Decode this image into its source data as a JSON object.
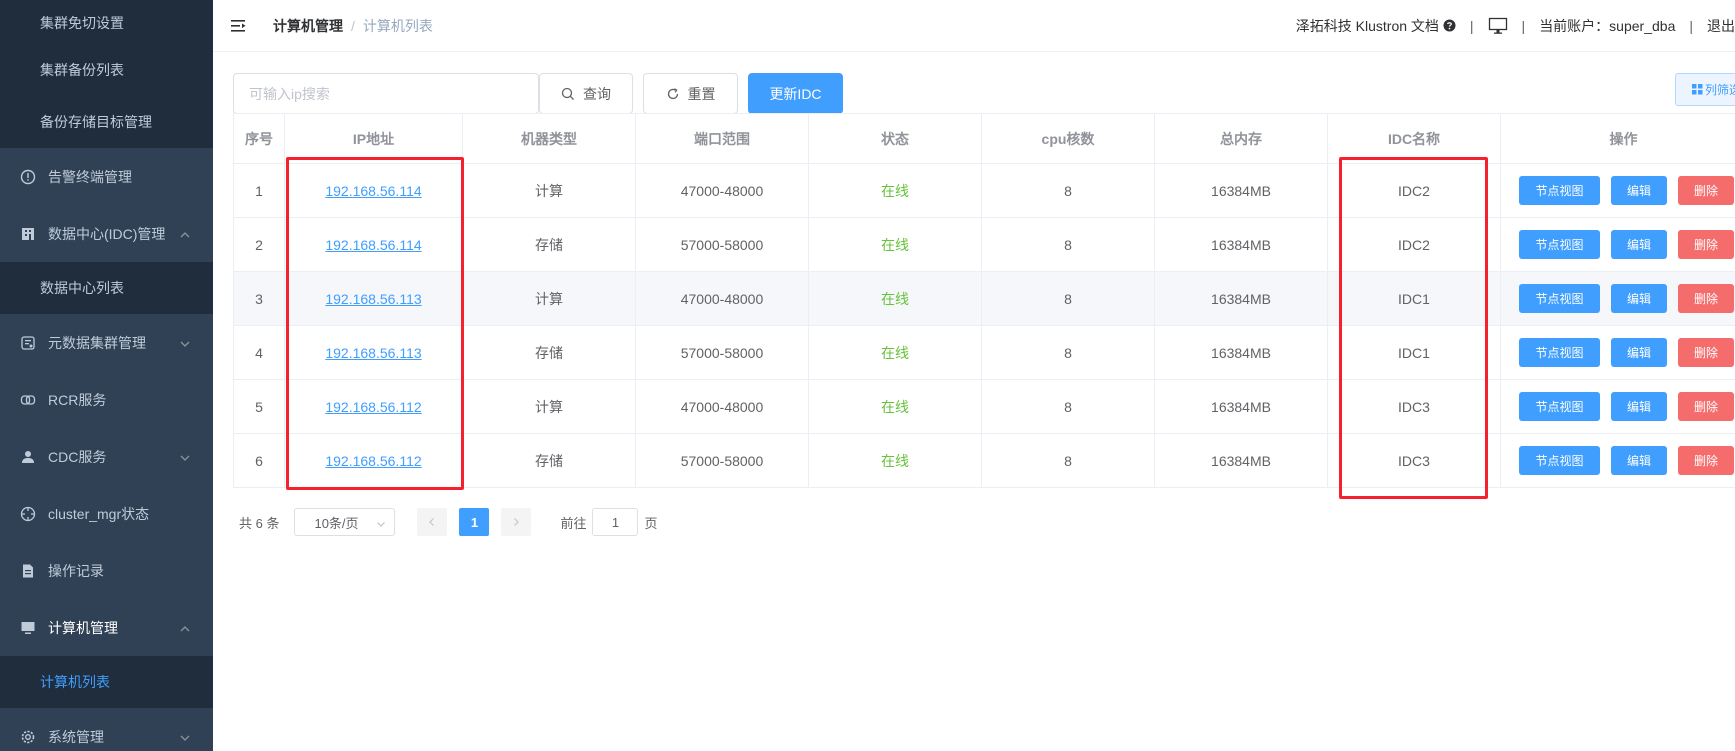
{
  "sidebar": {
    "top_items": [
      {
        "label": "集群免切设置"
      },
      {
        "label": "集群备份列表"
      },
      {
        "label": "备份存储目标管理"
      }
    ],
    "menu": {
      "alert": {
        "label": "告警终端管理",
        "icon": "alert-circle-icon"
      },
      "idc": {
        "label": "数据中心(IDC)管理",
        "icon": "building-icon",
        "expanded": true
      },
      "idc_list": {
        "label": "数据中心列表"
      },
      "meta": {
        "label": "元数据集群管理",
        "icon": "database-icon"
      },
      "rcr": {
        "label": "RCR服务",
        "icon": "link-icon"
      },
      "cdc": {
        "label": "CDC服务",
        "icon": "user-icon"
      },
      "cluster_mgr": {
        "label": "cluster_mgr状态",
        "icon": "compass-icon"
      },
      "oplog": {
        "label": "操作记录",
        "icon": "document-icon"
      },
      "machine": {
        "label": "计算机管理",
        "icon": "monitor-icon",
        "expanded": true
      },
      "machine_list": {
        "label": "计算机列表",
        "active": true
      },
      "system": {
        "label": "系统管理",
        "icon": "gear-icon"
      }
    }
  },
  "header": {
    "breadcrumb": [
      "计算机管理",
      "计算机列表"
    ],
    "docs_link": "泽拓科技 Klustron 文档",
    "sep": "|",
    "account": "当前账户：super_dba",
    "logout": "退出"
  },
  "toolbar": {
    "search_placeholder": "可输入ip搜索",
    "search_label": "查询",
    "reset_label": "重置",
    "update_idc_label": "更新IDC",
    "columns_label": "列筛选"
  },
  "table": {
    "columns": [
      "序号",
      "IP地址",
      "机器类型",
      "端口范围",
      "状态",
      "cpu核数",
      "总内存",
      "IDC名称",
      "操作"
    ],
    "actions": {
      "view": "节点视图",
      "edit": "编辑",
      "delete": "删除"
    },
    "rows": [
      {
        "no": "1",
        "ip": "192.168.56.114",
        "type": "计算",
        "ports": "47000-48000",
        "status": "在线",
        "cpu": "8",
        "mem": "16384MB",
        "idc": "IDC2"
      },
      {
        "no": "2",
        "ip": "192.168.56.114",
        "type": "存储",
        "ports": "57000-58000",
        "status": "在线",
        "cpu": "8",
        "mem": "16384MB",
        "idc": "IDC2"
      },
      {
        "no": "3",
        "ip": "192.168.56.113",
        "type": "计算",
        "ports": "47000-48000",
        "status": "在线",
        "cpu": "8",
        "mem": "16384MB",
        "idc": "IDC1"
      },
      {
        "no": "4",
        "ip": "192.168.56.113",
        "type": "存储",
        "ports": "57000-58000",
        "status": "在线",
        "cpu": "8",
        "mem": "16384MB",
        "idc": "IDC1"
      },
      {
        "no": "5",
        "ip": "192.168.56.112",
        "type": "计算",
        "ports": "47000-48000",
        "status": "在线",
        "cpu": "8",
        "mem": "16384MB",
        "idc": "IDC3"
      },
      {
        "no": "6",
        "ip": "192.168.56.112",
        "type": "存储",
        "ports": "57000-58000",
        "status": "在线",
        "cpu": "8",
        "mem": "16384MB",
        "idc": "IDC3"
      }
    ]
  },
  "pagination": {
    "total": "共 6 条",
    "page_size": "10条/页",
    "current_page": "1",
    "goto_prefix": "前往",
    "goto_value": "1",
    "goto_suffix": "页"
  },
  "colors": {
    "sidebar_bg": "#304156",
    "submenu_bg": "#1f2d3d",
    "primary": "#409eff",
    "success": "#67c23a",
    "danger": "#f56c6c",
    "annotation_red": "#f5222d"
  }
}
